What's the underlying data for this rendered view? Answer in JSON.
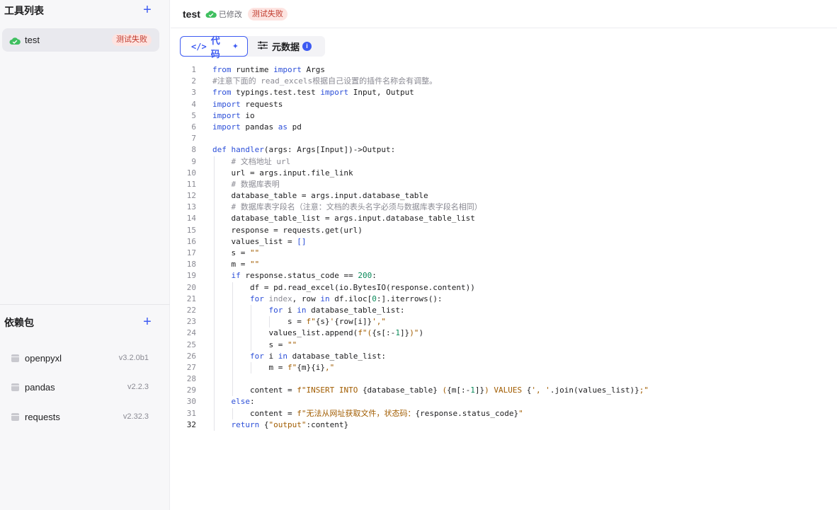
{
  "sidebar": {
    "tools_title": "工具列表",
    "add_icon": "plus-icon",
    "tool_items": [
      {
        "name": "test",
        "status": "测试失败"
      }
    ],
    "deps_title": "依赖包",
    "deps": [
      {
        "name": "openpyxl",
        "version": "v3.2.0b1"
      },
      {
        "name": "pandas",
        "version": "v2.2.3"
      },
      {
        "name": "requests",
        "version": "v2.32.3"
      }
    ]
  },
  "topbar": {
    "title": "test",
    "modified": "已修改",
    "status": "测试失败"
  },
  "tabs": {
    "code": "代码",
    "metadata": "元数据",
    "info": "i"
  },
  "editor": {
    "active_line": 32,
    "lines": [
      "1",
      "2",
      "3",
      "4",
      "5",
      "6",
      "7",
      "8",
      "9",
      "10",
      "11",
      "12",
      "13",
      "14",
      "15",
      "16",
      "17",
      "18",
      "19",
      "20",
      "21",
      "22",
      "23",
      "24",
      "25",
      "26",
      "27",
      "28",
      "29",
      "30",
      "31",
      "32"
    ]
  },
  "colors": {
    "accent": "#3e5bf2",
    "fail_text": "#c0392b",
    "fail_bg": "#fde4e1",
    "cloud_green": "#3fbf5f"
  }
}
